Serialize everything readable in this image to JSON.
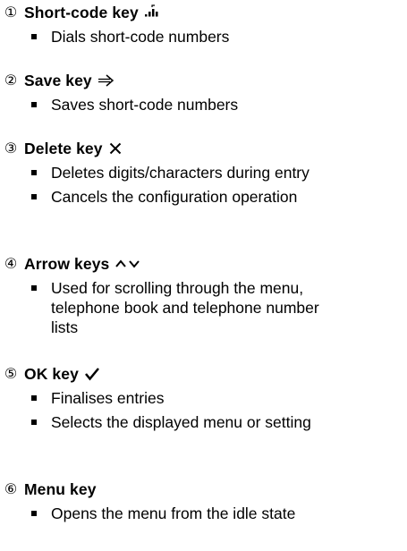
{
  "sections": [
    {
      "number": "①",
      "title": "Short-code key",
      "icon": "short-code-icon",
      "bullets": [
        "Dials short-code numbers"
      ]
    },
    {
      "number": "②",
      "title": "Save key",
      "icon": "save-arrow-icon",
      "bullets": [
        "Saves short-code numbers"
      ]
    },
    {
      "number": "③",
      "title": "Delete key",
      "icon": "delete-x-icon",
      "bullets": [
        "Deletes digits/characters during entry",
        "Cancels the configuration operation"
      ]
    },
    {
      "number": "④",
      "title": "Arrow keys",
      "icon": "arrow-up-down-icon",
      "bullets": [
        "Used for scrolling through the menu, telephone book and telephone number lists"
      ]
    },
    {
      "number": "⑤",
      "title": "OK key",
      "icon": "checkmark-icon",
      "bullets": [
        "Finalises entries",
        "Selects the displayed menu or setting"
      ]
    },
    {
      "number": "⑥",
      "title": "Menu key",
      "icon": "",
      "bullets": [
        "Opens the menu from the idle state"
      ]
    }
  ]
}
